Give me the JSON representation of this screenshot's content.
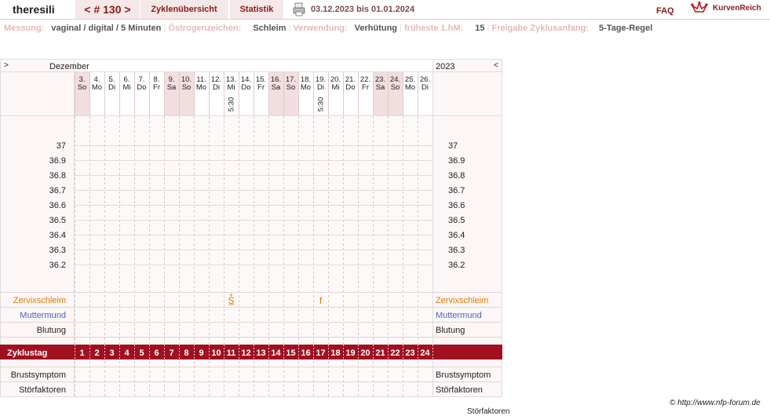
{
  "header": {
    "username": "theresili",
    "cycle_nav": "< # 130 >",
    "tabs": [
      "Zyklenübersicht",
      "Statistik"
    ],
    "date_range": "03.12.2023 bis 01.01.2024",
    "faq": "FAQ",
    "logo_text": "KurvenReich",
    "print_icon": "printer-icon"
  },
  "info": {
    "messung_label": "Messung:",
    "messung_value": "vaginal / digital / 5 Minuten",
    "oestrogen_label": "Östrogenzeichen:",
    "oestrogen_value": "Schleim",
    "verwendung_label": "Verwendung:",
    "verwendung_value": "Verhütung",
    "hm_label": "früheste 1.hM:",
    "hm_value": "15",
    "freigabe_label": "Freigabe Zyklusanfang:",
    "freigabe_value": "5-Tage-Regel"
  },
  "chart": {
    "nav_prev": ">",
    "nav_next": "<",
    "month": "Dezember",
    "year": "2023",
    "days": [
      {
        "d": "3.",
        "w": "So",
        "we": true
      },
      {
        "d": "4.",
        "w": "Mo",
        "we": false
      },
      {
        "d": "5.",
        "w": "Di",
        "we": false
      },
      {
        "d": "6.",
        "w": "Mi",
        "we": false
      },
      {
        "d": "7.",
        "w": "Do",
        "we": false
      },
      {
        "d": "8.",
        "w": "Fr",
        "we": false
      },
      {
        "d": "9.",
        "w": "Sa",
        "we": true
      },
      {
        "d": "10.",
        "w": "So",
        "we": true
      },
      {
        "d": "11.",
        "w": "Mo",
        "we": false
      },
      {
        "d": "12.",
        "w": "Di",
        "we": false
      },
      {
        "d": "13.",
        "w": "Mi",
        "we": false,
        "time": "5:30"
      },
      {
        "d": "14.",
        "w": "Do",
        "we": false
      },
      {
        "d": "15.",
        "w": "Fr",
        "we": false
      },
      {
        "d": "16.",
        "w": "Sa",
        "we": true
      },
      {
        "d": "17.",
        "w": "So",
        "we": true
      },
      {
        "d": "18.",
        "w": "Mo",
        "we": false
      },
      {
        "d": "19.",
        "w": "Di",
        "we": false,
        "time": "5:30"
      },
      {
        "d": "20.",
        "w": "Mi",
        "we": false
      },
      {
        "d": "21.",
        "w": "Do",
        "we": false
      },
      {
        "d": "22.",
        "w": "Fr",
        "we": false
      },
      {
        "d": "23.",
        "w": "Sa",
        "we": true
      },
      {
        "d": "24.",
        "w": "So",
        "we": true
      },
      {
        "d": "25.",
        "w": "Mo",
        "we": false
      },
      {
        "d": "26.",
        "w": "Di",
        "we": false
      }
    ],
    "temperatures": [
      "37",
      "36.9",
      "36.8",
      "36.7",
      "36.6",
      "36.5",
      "36.4",
      "36.3",
      "36.2"
    ],
    "rows": {
      "zervix": "Zervixschleim",
      "muttermund": "Muttermund",
      "blutung": "Blutung",
      "zyklustag": "Zyklustag",
      "brust": "Brustsymptom",
      "stoer": "Störfaktoren"
    },
    "zervix_marks": [
      {
        "day": 11,
        "symbol": "S̲",
        "top": "+"
      },
      {
        "day": 17,
        "symbol": "f"
      }
    ],
    "cycle_days": [
      "1",
      "2",
      "3",
      "4",
      "5",
      "6",
      "7",
      "8",
      "9",
      "10",
      "11",
      "12",
      "13",
      "14",
      "15",
      "16",
      "17",
      "18",
      "19",
      "20",
      "21",
      "22",
      "23",
      "24"
    ]
  },
  "footer": {
    "copyright": "© http://www.nfp-forum.de",
    "cutoff": "Störfaktoren"
  },
  "colors": {
    "accent": "#8b1a1a",
    "band": "#a01020",
    "weekend": "#f2dede",
    "zervix": "#e07800",
    "muttermund": "#4466cc"
  }
}
